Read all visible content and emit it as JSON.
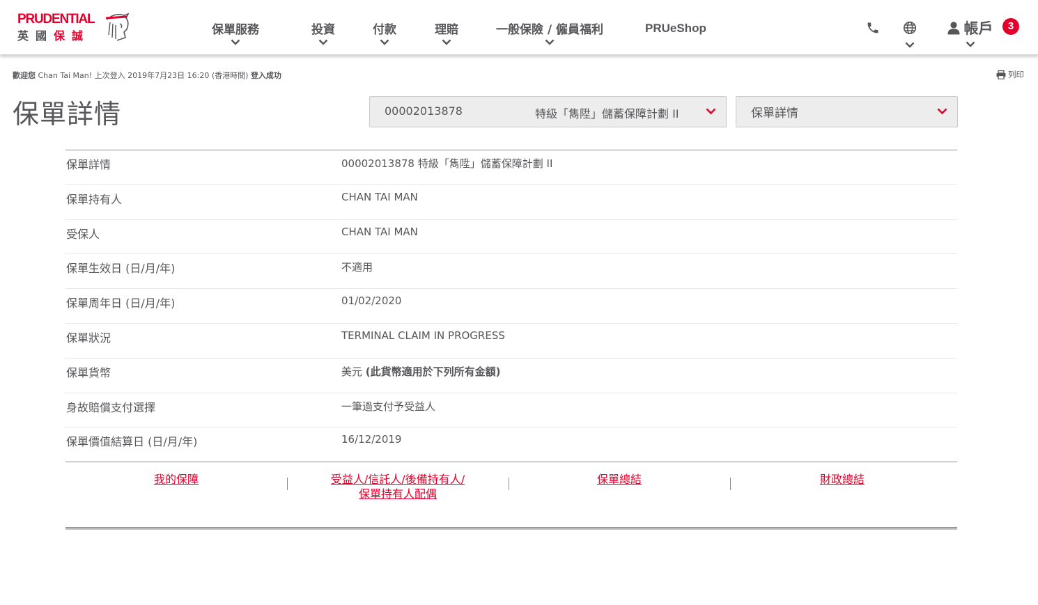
{
  "header": {
    "logo": {
      "en": "PRUDENTIAL",
      "zh_a": "英國",
      "zh_b": "保誠"
    },
    "nav": [
      {
        "label": "保單服務"
      },
      {
        "label": "投資"
      },
      {
        "label": "付款"
      },
      {
        "label": "理賠"
      },
      {
        "label": "一般保險 / 僱員福利"
      }
    ],
    "shop_label": "PRUeShop",
    "account_label": "帳戶",
    "notification_count": "3",
    "icons": [
      "phone-icon",
      "globe-icon",
      "user-icon"
    ]
  },
  "welcome": {
    "prefix": "歡迎您",
    "user": " Chan Tai Man! ",
    "last_login": "上次登入 2019年7月23日 16:20 (香港時間) ",
    "status": "登入成功"
  },
  "print_label": "列印",
  "page_title": "保單詳情",
  "policy_select": {
    "number": "00002013878",
    "plan": "特級「雋陞」儲蓄保障計劃 II"
  },
  "view_select": {
    "value": "保單詳情"
  },
  "details": [
    {
      "label": "保單詳情",
      "value": "00002013878 特級「雋陞」儲蓄保障計劃 II"
    },
    {
      "label": "保單持有人",
      "value": "CHAN TAI MAN"
    },
    {
      "label": "受保人",
      "value": "CHAN TAI MAN"
    },
    {
      "label": "保單生效日 (日/月/年)",
      "value": "不適用"
    },
    {
      "label": "保單周年日 (日/月/年)",
      "value": "01/02/2020"
    },
    {
      "label": "保單狀況",
      "value": "TERMINAL CLAIM IN PROGRESS"
    },
    {
      "label": "保單貨幣",
      "value": "美元 ",
      "note": "(此貨幣適用於下列所有金額)"
    },
    {
      "label": "身故賠償支付選擇",
      "value": "一筆過支付予受益人"
    },
    {
      "label": "保單價值結算日 (日/月/年)",
      "value": "16/12/2019"
    }
  ],
  "links": {
    "my_coverage": "我的保障",
    "beneficiary_line1": "受益人/信託人/後備持有人/",
    "beneficiary_line2": "保單持有人配偶",
    "policy_summary": "保單總結",
    "financial_summary": "財政總結"
  },
  "colors": {
    "brand_red": "#e4002b",
    "text_grey": "#57565a",
    "select_bg": "#ededed"
  }
}
